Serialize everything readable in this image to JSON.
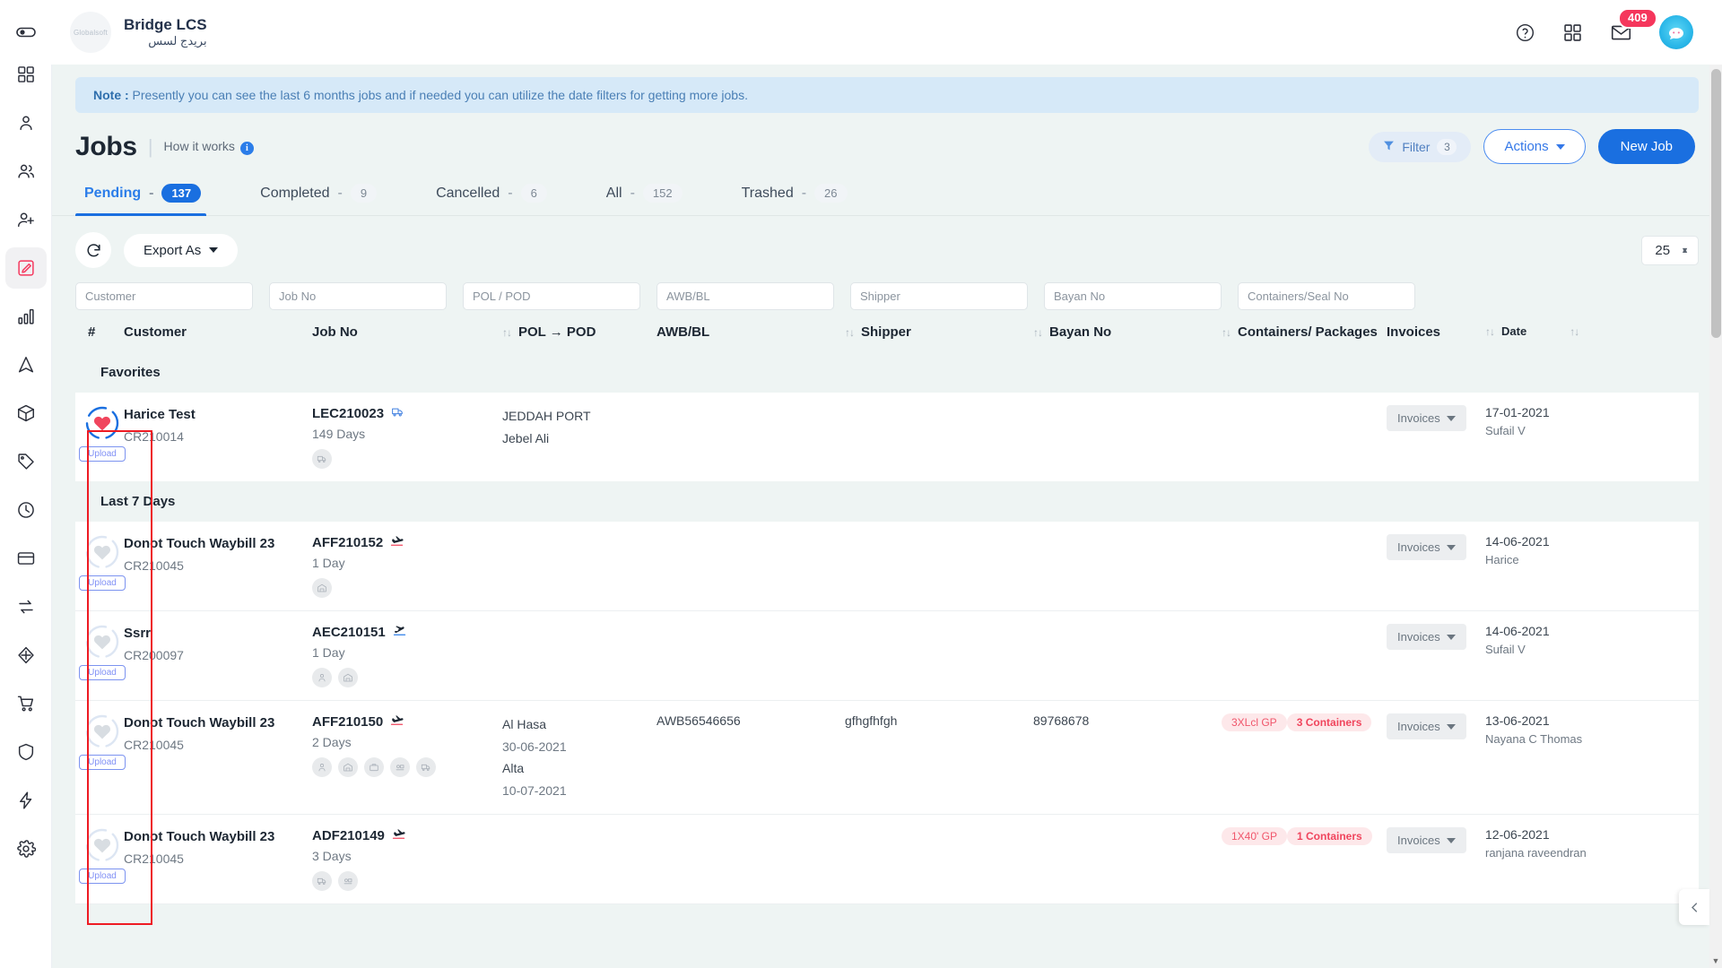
{
  "topbar": {
    "collapse_icon": "sidebar-toggle-icon",
    "brand_title": "Bridge LCS",
    "brand_subtitle": "بريدج لسس",
    "brand_logo_text": "Globalsoft",
    "help_icon": "help-circle-icon",
    "apps_icon": "grid-apps-icon",
    "mail_icon": "mail-icon",
    "mail_badge": "409",
    "avatar_icon": "user-avatar"
  },
  "sidebar": {
    "items": [
      {
        "icon": "dashboard-grid-icon",
        "name": "dashboard"
      },
      {
        "icon": "user-icon",
        "name": "customers"
      },
      {
        "icon": "users-icon",
        "name": "contacts"
      },
      {
        "icon": "user-add-icon",
        "name": "add-user"
      },
      {
        "icon": "edit-square-icon",
        "name": "jobs",
        "active": true
      },
      {
        "icon": "bar-chart-icon",
        "name": "reports"
      },
      {
        "icon": "navigation-arrow-icon",
        "name": "tracking"
      },
      {
        "icon": "box-icon",
        "name": "packages"
      },
      {
        "icon": "tag-icon",
        "name": "pricing"
      },
      {
        "icon": "clock-icon",
        "name": "history"
      },
      {
        "icon": "credit-card-icon",
        "name": "payments"
      },
      {
        "icon": "exchange-icon",
        "name": "transfers"
      },
      {
        "icon": "cube-icon",
        "name": "inventory"
      },
      {
        "icon": "cart-icon",
        "name": "orders"
      },
      {
        "icon": "shield-icon",
        "name": "security"
      },
      {
        "icon": "bolt-icon",
        "name": "automation"
      },
      {
        "icon": "gear-icon",
        "name": "settings"
      }
    ]
  },
  "note": {
    "label": "Note :",
    "text": " Presently you can see the last 6 months jobs and if needed you can utilize the date filters for getting more jobs."
  },
  "page": {
    "title": "Jobs",
    "how_it_works": "How it works",
    "info_icon": "info-icon"
  },
  "head_actions": {
    "filter_label": "Filter",
    "filter_count": "3",
    "filter_icon": "funnel-icon",
    "actions_label": "Actions",
    "new_job_label": "New Job"
  },
  "tabs": [
    {
      "label": "Pending",
      "dash": "-",
      "count": "137",
      "active": true
    },
    {
      "label": "Completed",
      "dash": "-",
      "count": "9",
      "active": false
    },
    {
      "label": "Cancelled",
      "dash": "-",
      "count": "6",
      "active": false
    },
    {
      "label": "All",
      "dash": "-",
      "count": "152",
      "active": false
    },
    {
      "label": "Trashed",
      "dash": "-",
      "count": "26",
      "active": false
    }
  ],
  "toolbar": {
    "refresh_icon": "refresh-icon",
    "export_label": "Export As",
    "page_size": "25"
  },
  "filters": {
    "customer": "Customer",
    "job_no": "Job No",
    "pol_pod": "POL / POD",
    "awb_bl": "AWB/BL",
    "shipper": "Shipper",
    "bayan_no": "Bayan No",
    "containers_seal": "Containers/Seal No"
  },
  "columns": {
    "num": "#",
    "customer": "Customer",
    "job_no": "Job No",
    "pol_pod": "POL → POD",
    "awb_bl": "AWB/BL",
    "shipper": "Shipper",
    "bayan_no": "Bayan No",
    "containers": "Containers/ Packages",
    "invoices": "Invoices",
    "date": "Date"
  },
  "sections": [
    {
      "title": "Favorites",
      "rows": [
        {
          "favorite": true,
          "upload_label": "Upload",
          "customer": "Harice Test",
          "customer_code": "CR210014",
          "job_no": "LEC210023",
          "job_icon": "truck-icon",
          "job_icon_color": "#3f7fe0",
          "days": "149 Days",
          "stage_badges": [
            "truck-icon"
          ],
          "pol": "JEDDAH PORT",
          "pol_date": "",
          "pod": "Jebel Ali",
          "pod_date": "",
          "awb_bl": "",
          "shipper": "",
          "bayan_no": "",
          "containers": [],
          "invoices_label": "Invoices",
          "date": "17-01-2021",
          "date_by": "Sufail V"
        }
      ]
    },
    {
      "title": "Last 7 Days",
      "rows": [
        {
          "favorite": false,
          "upload_label": "Upload",
          "customer": "Donot Touch Waybill 23",
          "customer_code": "CR210045",
          "job_no": "AFF210152",
          "job_icon": "plane-landing-icon",
          "job_icon_color": "#f0455d",
          "days": "1 Day",
          "stage_badges": [
            "warehouse-icon"
          ],
          "pol": "",
          "pol_date": "",
          "pod": "",
          "pod_date": "",
          "awb_bl": "",
          "shipper": "",
          "bayan_no": "",
          "containers": [],
          "invoices_label": "Invoices",
          "date": "14-06-2021",
          "date_by": "Harice"
        },
        {
          "favorite": false,
          "upload_label": "Upload",
          "customer": "Ssrr",
          "customer_code": "CR200097",
          "job_no": "AEC210151",
          "job_icon": "plane-takeoff-icon",
          "job_icon_color": "#2b7de9",
          "days": "1 Day",
          "stage_badges": [
            "person-icon",
            "warehouse-icon"
          ],
          "pol": "",
          "pol_date": "",
          "pod": "",
          "pod_date": "",
          "awb_bl": "",
          "shipper": "",
          "bayan_no": "",
          "containers": [],
          "invoices_label": "Invoices",
          "date": "14-06-2021",
          "date_by": "Sufail V"
        },
        {
          "favorite": false,
          "upload_label": "Upload",
          "customer": "Donot Touch Waybill 23",
          "customer_code": "CR210045",
          "job_no": "AFF210150",
          "job_icon": "plane-landing-icon",
          "job_icon_color": "#f0455d",
          "days": "2 Days",
          "stage_badges": [
            "person-icon",
            "warehouse-icon",
            "customs-icon",
            "transit-icon",
            "truck-icon"
          ],
          "pol": "Al Hasa",
          "pol_date": "30-06-2021",
          "pod": "Alta",
          "pod_date": "10-07-2021",
          "awb_bl": "AWB56546656",
          "shipper": "gfhgfhfgh",
          "bayan_no": "89768678",
          "containers": [
            "3XLcl GP",
            "3 Containers"
          ],
          "invoices_label": "Invoices",
          "date": "13-06-2021",
          "date_by": "Nayana C Thomas"
        },
        {
          "favorite": false,
          "upload_label": "Upload",
          "customer": "Donot Touch Waybill 23",
          "customer_code": "CR210045",
          "job_no": "ADF210149",
          "job_icon": "plane-landing-icon",
          "job_icon_color": "#f0455d",
          "days": "3 Days",
          "stage_badges": [
            "truck-icon",
            "transit-icon"
          ],
          "pol": "",
          "pol_date": "",
          "pod": "",
          "pod_date": "",
          "awb_bl": "",
          "shipper": "",
          "bayan_no": "",
          "containers": [
            "1X40' GP",
            "1 Containers"
          ],
          "invoices_label": "Invoices",
          "date": "12-06-2021",
          "date_by": "ranjana raveendran"
        }
      ]
    }
  ],
  "colors": {
    "accent_blue": "#1a6fe0",
    "accent_red": "#f5365c",
    "note_bg": "#d6e9f8",
    "page_bg": "#eef4f3",
    "annotation_red": "#ee1b23"
  }
}
